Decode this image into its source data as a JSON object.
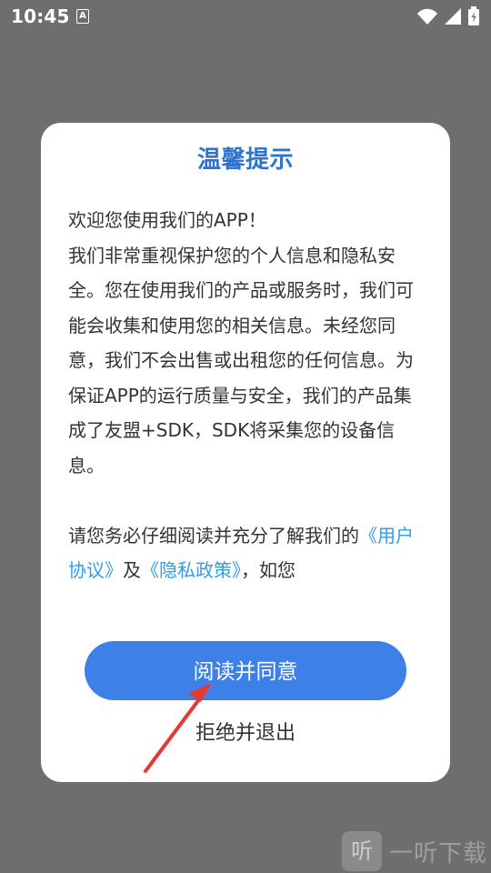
{
  "status_bar": {
    "time": "10:45",
    "notification_icon": "A"
  },
  "dialog": {
    "title": "温馨提示",
    "paragraphs": {
      "welcome": "欢迎您使用我们的APP！",
      "body_1": "我们非常重视保护您的个人信息和隐私安全。您在使用我们的产品或服务时，我们可能会收集和使用您的相关信息。未经您同意，我们不会出售或出租您的任何信息。为保证APP的运行质量与安全，我们的产品集成了友盟+SDK，SDK将采集您的设备信息。",
      "body_2_prefix": "请您务必仔细阅读并充分了解我们的",
      "user_agreement_link": "《用户协议》",
      "connector": "及",
      "privacy_policy_link": "《隐私政策》",
      "body_2_suffix": "，如您"
    },
    "agree_label": "阅读并同意",
    "decline_label": "拒绝并退出"
  },
  "watermark": {
    "logo_text": "听",
    "text": "一听下载"
  },
  "colors": {
    "overlay": "#6e6e6e",
    "title": "#2f73d1",
    "primary_button": "#3d80e8",
    "link": "#2f9de6",
    "arrow": "#e53935"
  },
  "icons": {
    "wifi": "wifi-icon",
    "cellular": "cellular-signal-icon",
    "battery": "battery-icon",
    "notification": "text-notification-icon"
  }
}
